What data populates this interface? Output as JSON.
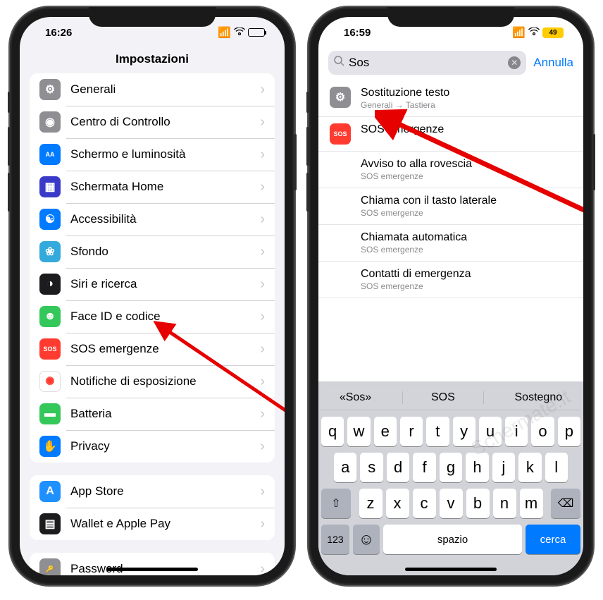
{
  "left": {
    "time": "16:26",
    "title": "Impostazioni",
    "group1": [
      {
        "label": "Generali",
        "iconBg": "#8e8e93",
        "iconChar": "⚙"
      },
      {
        "label": "Centro di Controllo",
        "iconBg": "#8e8e93",
        "iconChar": "◉"
      },
      {
        "label": "Schermo e luminosità",
        "iconBg": "#007aff",
        "iconChar": "AA"
      },
      {
        "label": "Schermata Home",
        "iconBg": "#3a3ac9",
        "iconChar": "▦"
      },
      {
        "label": "Accessibilità",
        "iconBg": "#007aff",
        "iconChar": "☯"
      },
      {
        "label": "Sfondo",
        "iconBg": "#34aadc",
        "iconChar": "❀"
      },
      {
        "label": "Siri e ricerca",
        "iconBg": "#1c1c1e",
        "iconChar": "◑"
      },
      {
        "label": "Face ID e codice",
        "iconBg": "#34c759",
        "iconChar": "☻"
      },
      {
        "label": "SOS emergenze",
        "iconBg": "#ff3b30",
        "iconChar": "SOS"
      },
      {
        "label": "Notifiche di esposizione",
        "iconBg": "#ffffff",
        "iconChar": "✺"
      },
      {
        "label": "Batteria",
        "iconBg": "#34c759",
        "iconChar": "▬"
      },
      {
        "label": "Privacy",
        "iconBg": "#007aff",
        "iconChar": "✋"
      }
    ],
    "group2": [
      {
        "label": "App Store",
        "iconBg": "#1e90ff",
        "iconChar": "A"
      },
      {
        "label": "Wallet e Apple Pay",
        "iconBg": "#1c1c1e",
        "iconChar": "▤"
      }
    ],
    "group3": [
      {
        "label": "Password",
        "iconBg": "#8e8e93",
        "iconChar": "🔑"
      }
    ]
  },
  "right": {
    "time": "16:59",
    "battery": "49",
    "search_value": "Sos",
    "cancel": "Annulla",
    "results": [
      {
        "title": "Sostituzione testo",
        "sub": "Generali → Tastiera",
        "iconBg": "#8e8e93",
        "iconChar": "⚙"
      },
      {
        "title": "SOS emergenze",
        "sub": "",
        "iconBg": "#ff3b30",
        "iconChar": "SOS"
      },
      {
        "title": "Avviso    to alla rovescia",
        "sub": "SOS emergenze",
        "iconBg": "",
        "iconChar": ""
      },
      {
        "title": "Chiama con il tasto laterale",
        "sub": "SOS emergenze",
        "iconBg": "",
        "iconChar": ""
      },
      {
        "title": "Chiamata automatica",
        "sub": "SOS emergenze",
        "iconBg": "",
        "iconChar": ""
      },
      {
        "title": "Contatti di emergenza",
        "sub": "SOS emergenze",
        "iconBg": "",
        "iconChar": ""
      }
    ],
    "suggestions": [
      "«Sos»",
      "SOS",
      "Sostegno"
    ],
    "row1": [
      "q",
      "w",
      "e",
      "r",
      "t",
      "y",
      "u",
      "i",
      "o",
      "p"
    ],
    "row2": [
      "a",
      "s",
      "d",
      "f",
      "g",
      "h",
      "j",
      "k",
      "l"
    ],
    "row3": [
      "z",
      "x",
      "c",
      "v",
      "b",
      "n",
      "m"
    ],
    "space": "spazio",
    "return": "cerca",
    "numkey": "123"
  },
  "watermark": "Schermate.it"
}
